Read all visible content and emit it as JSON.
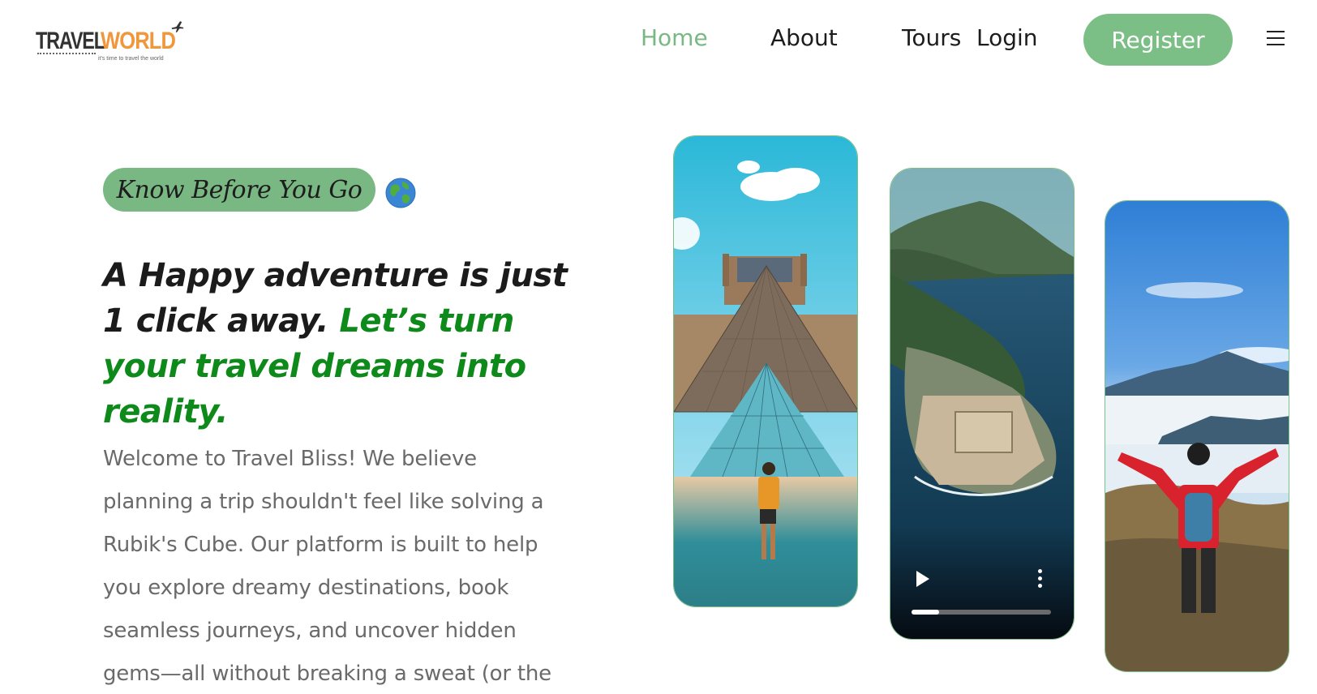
{
  "brand": {
    "name_part1": "TRAVEL",
    "name_part2": "WORLD",
    "tagline": "it's time to travel the world",
    "accent_color": "#f1963a"
  },
  "nav": {
    "links": [
      {
        "label": "Home",
        "active": true
      },
      {
        "label": "About",
        "active": false
      },
      {
        "label": "Tours",
        "active": false
      },
      {
        "label": "Login",
        "active": false
      }
    ],
    "register_label": "Register",
    "menu_icon": "hamburger-icon",
    "accent_color": "#79b883"
  },
  "hero": {
    "badge_text": "Know Before You Go",
    "badge_icon": "globe-icon",
    "headline_part1": "A Happy adventure is just 1 click away. ",
    "headline_part2": "Let’s turn your travel dreams into reality.",
    "headline_accent_color": "#0e8a1a",
    "intro": "Welcome to Travel Bliss! We believe planning a trip shouldn't feel like solving a Rubik's Cube. Our platform is built to help you explore dreamy destinations, book seamless journeys, and uncover hidden gems—all without breaking a sweat (or the"
  },
  "gallery": {
    "cards": [
      {
        "subject": "louvre-pyramid-photo"
      },
      {
        "subject": "coastal-fortress-video",
        "progress": 0.2
      },
      {
        "subject": "mountain-hiker-photo"
      }
    ]
  }
}
